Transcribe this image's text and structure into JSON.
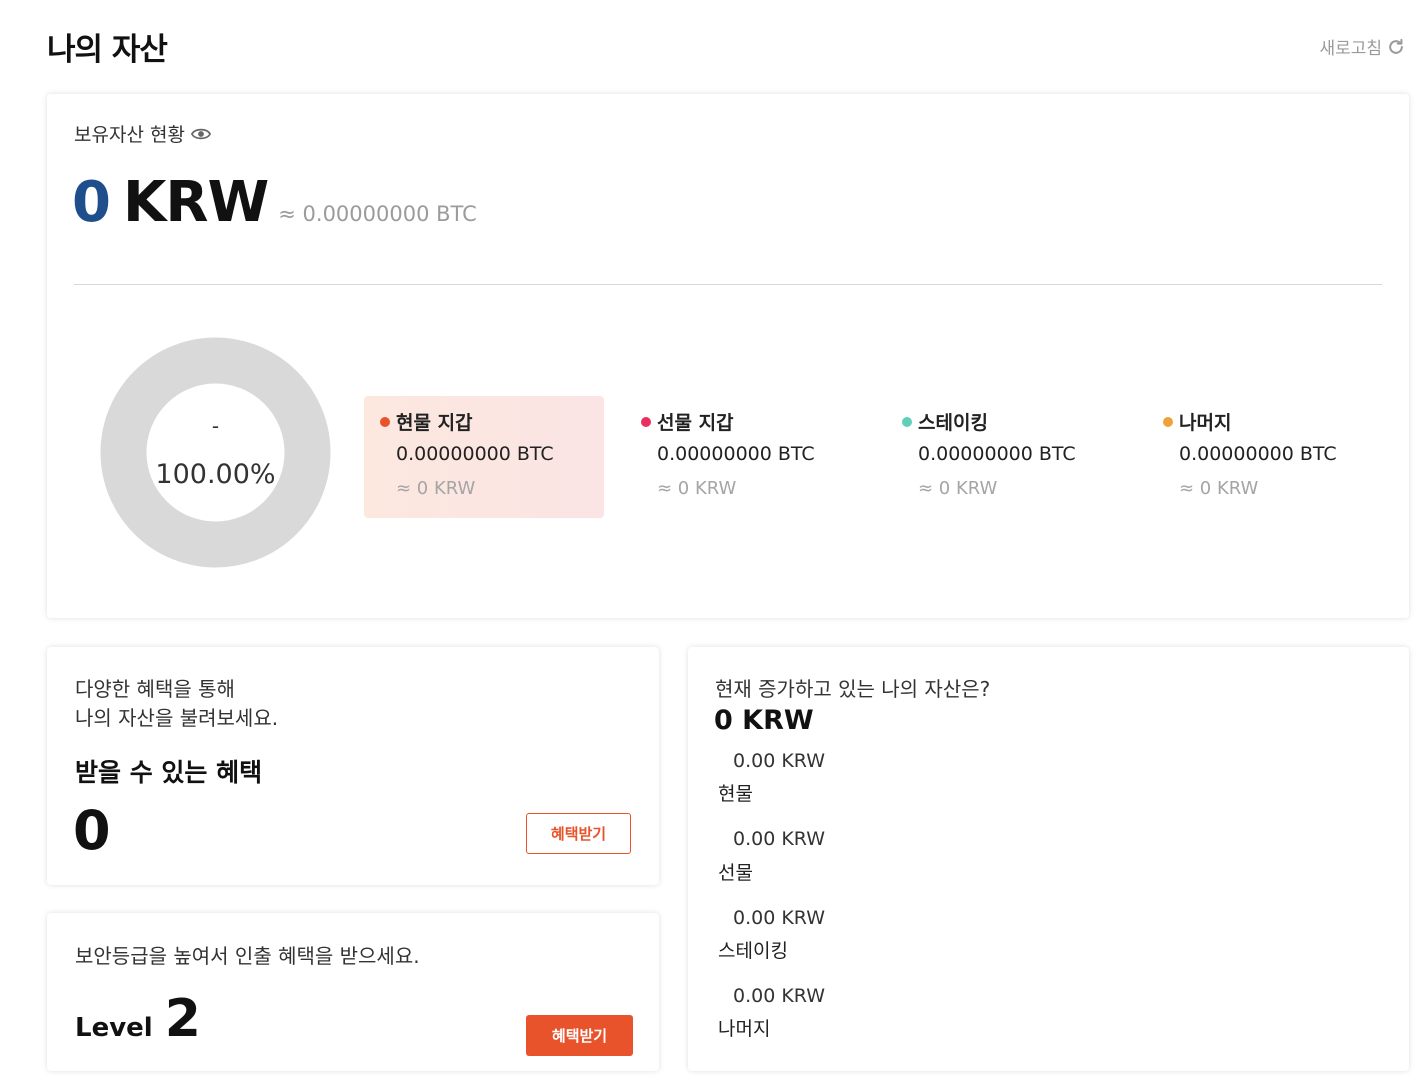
{
  "header": {
    "title": "나의 자산",
    "refresh_label": "새로고침"
  },
  "holdings": {
    "title": "보유자산 현황",
    "total_value": "0",
    "total_currency": "KRW",
    "total_btc": "≈ 0.00000000 BTC",
    "donut": {
      "center_label": "-",
      "center_percent": "100.00%",
      "fill_percent": 100,
      "color": "#d9d9d9"
    },
    "categories": [
      {
        "name": "현물 지갑",
        "btc": "0.00000000 BTC",
        "krw": "≈ 0 KRW",
        "color": "#e9532b"
      },
      {
        "name": "선물 지갑",
        "btc": "0.00000000 BTC",
        "krw": "≈ 0 KRW",
        "color": "#e8305e"
      },
      {
        "name": "스테이킹",
        "btc": "0.00000000 BTC",
        "krw": "≈ 0 KRW",
        "color": "#5fd0b8"
      },
      {
        "name": "나머지",
        "btc": "0.00000000 BTC",
        "krw": "≈ 0 KRW",
        "color": "#f0a23a"
      }
    ]
  },
  "benefits": {
    "line1": "다양한 혜택을 통해",
    "line2": "나의 자산을 불려보세요.",
    "label": "받을 수 있는 혜택",
    "count": "0",
    "button_label": "혜택받기"
  },
  "security": {
    "text": "보안등급을 높여서 인출 혜택을 받으세요.",
    "level_label": "Level",
    "level_value": "2",
    "button_label": "혜택받기"
  },
  "growth": {
    "question": "현재 증가하고 있는 나의 자산은?",
    "total": "0 KRW",
    "items": [
      {
        "value": "0.00 KRW",
        "name": "현물"
      },
      {
        "value": "0.00 KRW",
        "name": "선물"
      },
      {
        "value": "0.00 KRW",
        "name": "스테이킹"
      },
      {
        "value": "0.00 KRW",
        "name": "나머지"
      }
    ]
  },
  "colors": {
    "accent": "#e9532b",
    "total_number": "#1f4e8c"
  }
}
